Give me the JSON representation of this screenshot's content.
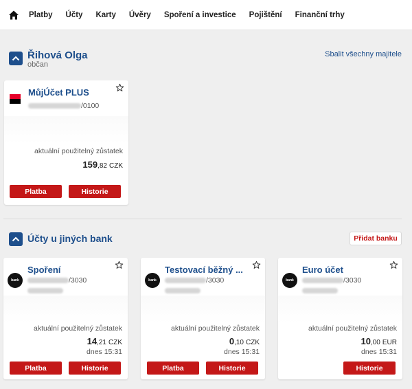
{
  "nav": {
    "items": [
      "Platby",
      "Účty",
      "Karty",
      "Úvěry",
      "Spoření a investice",
      "Pojištění",
      "Finanční trhy"
    ]
  },
  "owner": {
    "name": "Řihová Olga",
    "role": "občan",
    "collapse_all_label": "Sbalit všechny majitele"
  },
  "main_account": {
    "name": "MůjÚčet PLUS",
    "number_suffix": "/0100",
    "balance_label": "aktuální použitelný zůstatek",
    "balance_whole": "159",
    "balance_decimal": ",82",
    "currency": "CZK",
    "pay_label": "Platba",
    "history_label": "Historie"
  },
  "other_banks": {
    "title": "Účty u jiných bank",
    "add_bank_label": "Přidat banku",
    "logo_text": "bank",
    "accounts": [
      {
        "name": "Spoření",
        "number_suffix": "/3030",
        "balance_label": "aktuální použitelný zůstatek",
        "balance_whole": "14",
        "balance_decimal": ",21",
        "currency": "CZK",
        "date": "dnes 15:31",
        "pay_label": "Platba",
        "history_label": "Historie"
      },
      {
        "name": "Testovací běžný ...",
        "number_suffix": "/3030",
        "balance_label": "aktuální použitelný zůstatek",
        "balance_whole": "0",
        "balance_decimal": ",10",
        "currency": "CZK",
        "date": "dnes 15:31",
        "pay_label": "Platba",
        "history_label": "Historie"
      },
      {
        "name": "Euro účet",
        "number_suffix": "/3030",
        "balance_label": "aktuální použitelný zůstatek",
        "balance_whole": "10",
        "balance_decimal": ",00",
        "currency": "EUR",
        "date": "dnes 15:31",
        "history_label": "Historie"
      }
    ]
  },
  "colors": {
    "brand_blue": "#1e4f8c",
    "button_red": "#c41818",
    "background": "#efefef"
  }
}
